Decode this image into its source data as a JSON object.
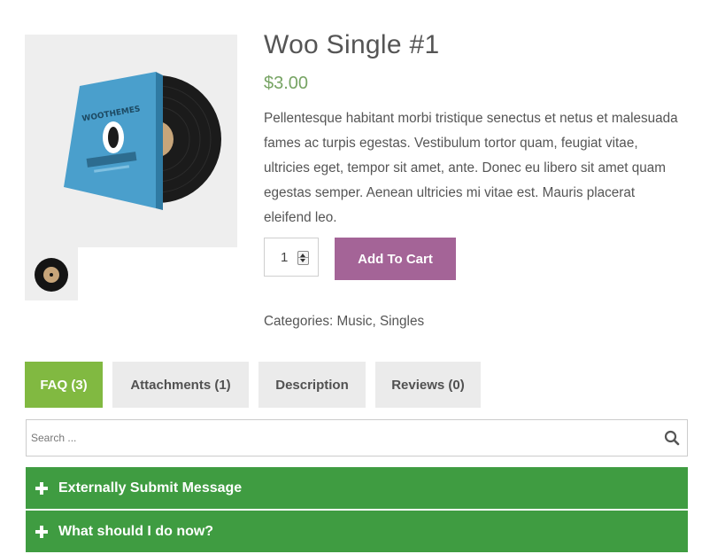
{
  "product": {
    "title": "Woo Single #1",
    "price": "$3.00",
    "description": "Pellentesque habitant morbi tristique senectus et netus et malesuada fames ac turpis egestas. Vestibulum tortor quam, feugiat vitae, ultricies eget, tempor sit amet, ante. Donec eu libero sit amet quam egestas semper. Aenean ultricies mi vitae est. Mauris placerat eleifend leo.",
    "image_cover_text": "WOOTHEMES",
    "quantity": "1",
    "add_to_cart_label": "Add To Cart",
    "categories_label": "Categories:",
    "categories": [
      "Music",
      "Singles"
    ]
  },
  "tabs": [
    {
      "label": "FAQ (3)",
      "active": true
    },
    {
      "label": "Attachments (1)",
      "active": false
    },
    {
      "label": "Description",
      "active": false
    },
    {
      "label": "Reviews (0)",
      "active": false
    }
  ],
  "search": {
    "placeholder": "Search ..."
  },
  "faq_items": [
    {
      "question": "Externally Submit Message"
    },
    {
      "question": "What should I do now?"
    }
  ],
  "colors": {
    "price": "#77a464",
    "add_to_cart": "#a46497",
    "active_tab": "#81b941",
    "inactive_tab": "#ebebeb",
    "faq_bar": "#3f9c41"
  }
}
